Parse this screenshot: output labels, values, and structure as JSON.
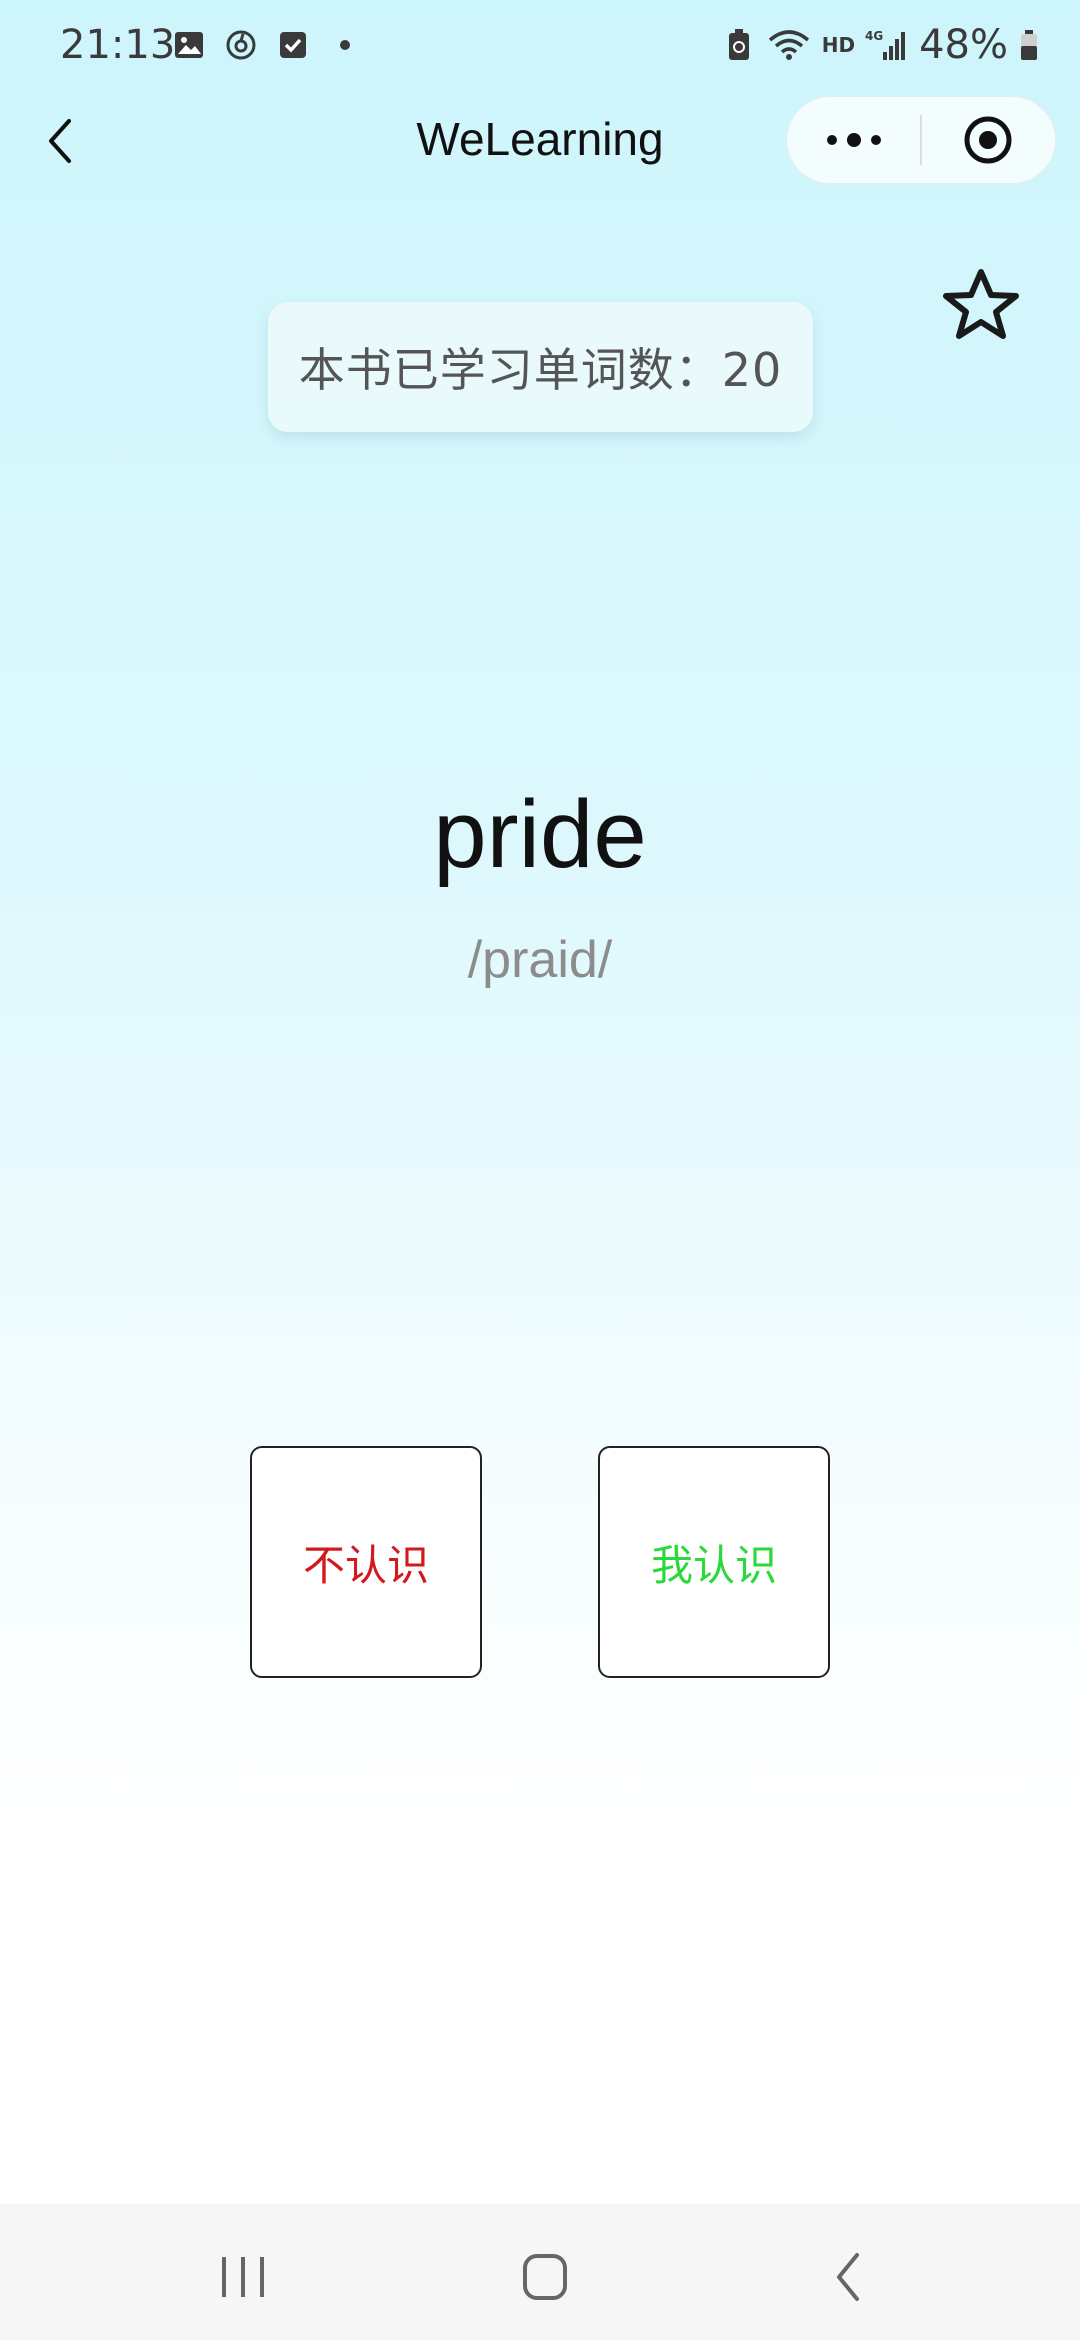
{
  "status_bar": {
    "time": "21:13",
    "network": "4G",
    "hd": "HD",
    "battery": "48%"
  },
  "header": {
    "title": "WeLearning"
  },
  "learned": {
    "label": "本书已学习单词数：20"
  },
  "word": {
    "text": "pride",
    "phonetic": "/praid/"
  },
  "buttons": {
    "unknown_label": "不认识",
    "known_label": "我认识"
  },
  "colors": {
    "unknown": "#d2191c",
    "known": "#2bd93a"
  },
  "icons": {
    "back": "chevron-left-icon",
    "more": "more-dots-icon",
    "close": "target-icon",
    "favorite": "star-outline-icon"
  }
}
